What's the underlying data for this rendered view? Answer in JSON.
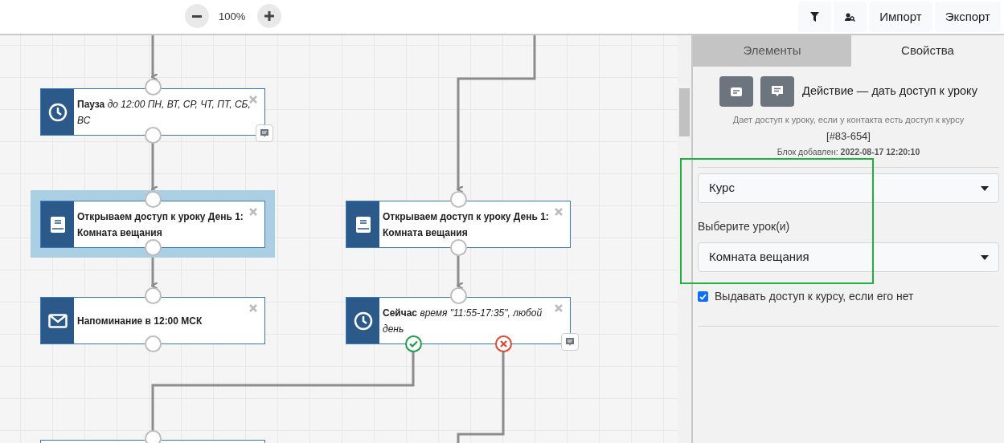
{
  "toolbar": {
    "zoom": "100%",
    "buttons": [
      {
        "kind": "filter"
      },
      {
        "kind": "user-search"
      },
      {
        "kind": "text",
        "label": "Импорт"
      },
      {
        "kind": "text",
        "label": "Экспорт"
      }
    ]
  },
  "nodes": [
    {
      "kind": "clock",
      "title": "Пауза",
      "detail": "до 12:00 ПН, ВТ, СР, ЧТ, ПТ, СБ, ВС",
      "selected": false,
      "comment": true,
      "branches": false
    },
    {
      "kind": "book",
      "title": "Открываем доступ к уроку День 1: Комната вещания",
      "selected": true,
      "comment": false,
      "branches": false
    },
    {
      "kind": "mail",
      "title": "Напоминание в 12:00 МСК",
      "selected": false,
      "comment": false,
      "branches": false
    },
    {
      "kind": "book",
      "title": "Открываем доступ к уроку День 1: Комната вещания",
      "selected": false,
      "comment": false,
      "branches": false
    },
    {
      "kind": "clock",
      "title": "Сейчас",
      "detail": "время \"11:55-17:35\", любой день",
      "selected": false,
      "comment": true,
      "branches": true
    }
  ],
  "panel": {
    "tabs": [
      {
        "label": "Элементы",
        "selected": false
      },
      {
        "label": "Свойства",
        "selected": true
      }
    ],
    "title": "Действие — дать доступ к уроку",
    "description": "Дает доступ к уроку, если у контакта есть доступ к курсу",
    "block_id": "[#83-654]",
    "added": "Блок добавлен: **2022-08-17 12:20:10**",
    "course_select": "Курс",
    "lesson_label": "Выберите урок(и)",
    "lesson_select": "Комната вещания",
    "grant_access": {
      "label": "Выдавать доступ к курсу, если его нет",
      "checked": true
    }
  }
}
